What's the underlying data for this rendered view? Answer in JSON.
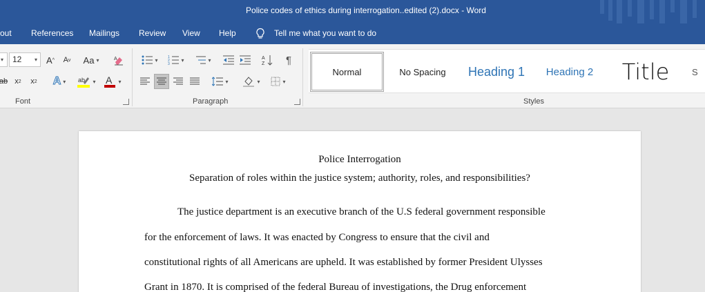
{
  "window": {
    "title": "Police codes of ethics during interrogation..edited (2).docx  -  Word"
  },
  "tabs": [
    {
      "label": "out"
    },
    {
      "label": "References"
    },
    {
      "label": "Mailings"
    },
    {
      "label": "Review"
    },
    {
      "label": "View"
    },
    {
      "label": "Help"
    }
  ],
  "tell_me": {
    "label": "Tell me what you want to do",
    "icon": "lightbulb-icon"
  },
  "font_group": {
    "label": "Font",
    "font_size": "12",
    "change_case_label": "Aa",
    "colors": {
      "highlight": "#ffff00",
      "font_color": "#c00000"
    }
  },
  "paragraph_group": {
    "label": "Paragraph"
  },
  "styles_group": {
    "label": "Styles",
    "items": [
      {
        "label": "Normal"
      },
      {
        "label": "No Spacing"
      },
      {
        "label": "Heading 1"
      },
      {
        "label": "Heading 2"
      },
      {
        "label": "Title"
      },
      {
        "label": "S"
      }
    ]
  },
  "document": {
    "heading": "Police Interrogation",
    "subheading": "Separation of roles within the justice system; authority, roles, and responsibilities?",
    "lines": [
      "The justice department is an executive branch of the U.S federal government responsible",
      "for the enforcement of laws. It was enacted by Congress to ensure that the civil and",
      "constitutional rights of all Americans are upheld. It was established by former President Ulysses",
      "Grant in 1870. It is comprised of the federal Bureau of investigations, the Drug enforcement"
    ]
  },
  "colors": {
    "brand": "#2b579a",
    "ribbon": "#f3f3f3",
    "heading_blue": "#2e74b5"
  }
}
